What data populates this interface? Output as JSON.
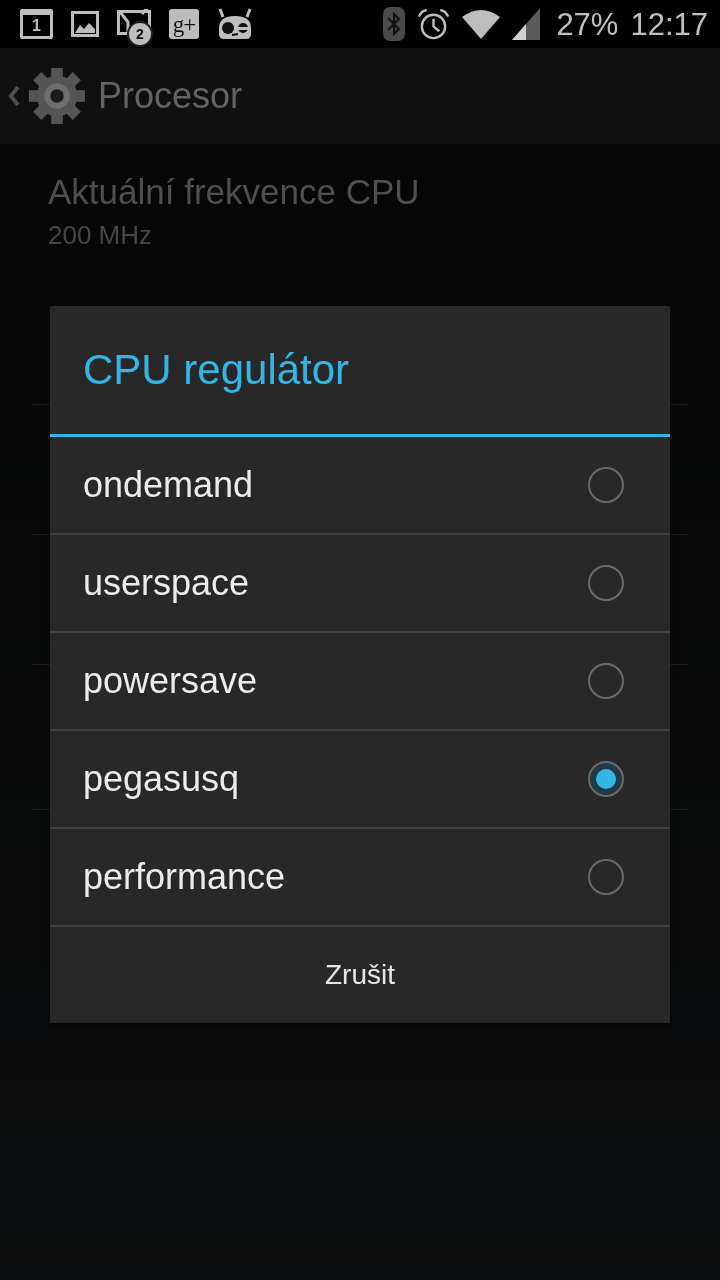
{
  "status_bar": {
    "notifications": [
      {
        "kind": "calendar",
        "label": "1"
      },
      {
        "kind": "image"
      },
      {
        "kind": "mail",
        "badge": "2"
      },
      {
        "kind": "gplus",
        "label": "g+"
      },
      {
        "kind": "robot"
      }
    ],
    "battery": "27%",
    "time": "12:17"
  },
  "action_bar": {
    "title": "Procesor"
  },
  "preferences": [
    {
      "title": "Aktuální frekvence CPU",
      "summary": "200 MHz"
    }
  ],
  "dialog": {
    "title": "CPU regulátor",
    "options": [
      {
        "label": "ondemand",
        "selected": false
      },
      {
        "label": "userspace",
        "selected": false
      },
      {
        "label": "powersave",
        "selected": false
      },
      {
        "label": "pegasusq",
        "selected": true
      },
      {
        "label": "performance",
        "selected": false
      }
    ],
    "button": "Zrušit"
  }
}
